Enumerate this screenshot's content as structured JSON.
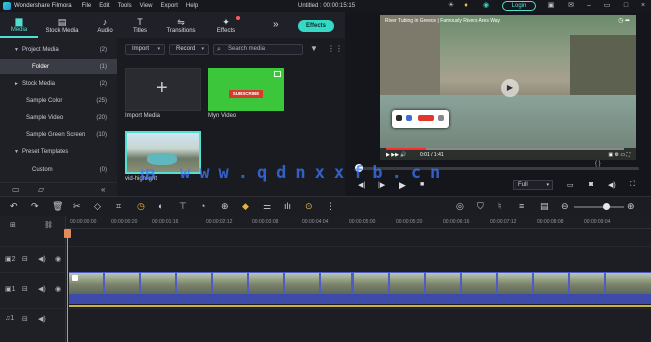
{
  "titlebar": {
    "app_name": "Wondershare Filmora",
    "menus": [
      "File",
      "Edit",
      "Tools",
      "View",
      "Export",
      "Help"
    ],
    "doc_title": "Untitled : 00:00:15:15",
    "login": "Login"
  },
  "library_tabs": [
    {
      "label": "Media",
      "icon": "folder-icon",
      "active": true
    },
    {
      "label": "Stock Media",
      "icon": "film-icon",
      "active": false
    },
    {
      "label": "Audio",
      "icon": "music-icon",
      "active": false
    },
    {
      "label": "Titles",
      "icon": "text-icon",
      "active": false
    },
    {
      "label": "Transitions",
      "icon": "transition-icon",
      "active": false
    },
    {
      "label": "Effects",
      "icon": "sparkle-icon",
      "active": false
    }
  ],
  "effects_button": "Effects",
  "library_tree": [
    {
      "label": "Project Media",
      "count": "(2)",
      "arrow": "▼",
      "indent": false,
      "selected": false
    },
    {
      "label": "Folder",
      "count": "(1)",
      "arrow": "",
      "indent": true,
      "selected": true
    },
    {
      "label": "Stock Media",
      "count": "(2)",
      "arrow": "►",
      "indent": false,
      "selected": false
    },
    {
      "label": "Sample Color",
      "count": "(25)",
      "arrow": "",
      "indent": true,
      "selected": false
    },
    {
      "label": "Sample Video",
      "count": "(20)",
      "arrow": "",
      "indent": true,
      "selected": false
    },
    {
      "label": "Sample Green Screen",
      "count": "(10)",
      "arrow": "",
      "indent": true,
      "selected": false
    },
    {
      "label": "Preset Templates",
      "count": "",
      "arrow": "▼",
      "indent": false,
      "selected": false
    },
    {
      "label": "Custom",
      "count": "(0)",
      "arrow": "",
      "indent": true,
      "selected": false
    }
  ],
  "media_toolbar": {
    "import_label": "Import",
    "record_label": "Record",
    "search_placeholder": "Search media"
  },
  "media_items": [
    {
      "label": "Import Media"
    },
    {
      "label": "Myn Video",
      "overlay": "SUBSCRIBE"
    },
    {
      "label": "vid-highlight"
    }
  ],
  "preview": {
    "video_title": "River Tubing in Greece | Famously Rivers Ares Way",
    "time_display": "{    }",
    "quality": "Full",
    "player_time": "0:01 / 1:41"
  },
  "timeline": {
    "ruler_ticks": [
      "00:00:00:00",
      "00:00:00:20",
      "00:00:01:16",
      "00:00:02:12",
      "00:00:03:08",
      "00:00:04:04",
      "00:00:05:00",
      "00:00:05:20",
      "00:00:06:16",
      "00:00:07:12",
      "00:00:08:08",
      "00:00:09:04"
    ],
    "track_labels": [
      "2",
      "1",
      "1"
    ]
  },
  "watermark": {
    "left": "tB",
    "text": "www.qdnxxfb.cn"
  }
}
